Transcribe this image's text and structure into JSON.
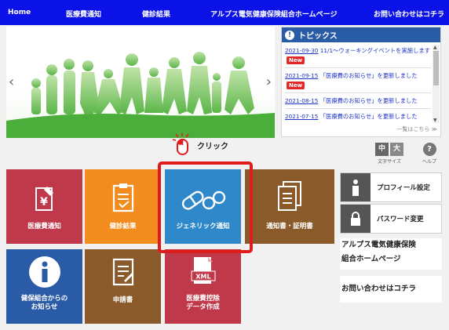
{
  "nav": {
    "items": [
      "Home",
      "医療費通知",
      "健診結果",
      "アルプス電気健康保険組合ホームページ",
      "お問い合わせはコチラ"
    ]
  },
  "hero": {
    "prev_arrow": "‹",
    "next_arrow": "›"
  },
  "topics": {
    "title": "トピックス",
    "icon": "!",
    "items": [
      {
        "date": "2021-09-30",
        "text": "11/1～ウォーキングイベントを実施します！",
        "new": "New"
      },
      {
        "date": "2021-09-15",
        "text": "「医療費のお知らせ」を更新しました",
        "new": "New"
      },
      {
        "date": "2021-08-15",
        "text": "「医療費のお知らせ」を更新しました",
        "new": ""
      },
      {
        "date": "2021-07-15",
        "text": "「医療費のお知らせ」を更新しました",
        "new": ""
      }
    ],
    "more": "一覧はこちら ≫"
  },
  "click_note": "クリック",
  "tools": {
    "font_small": "中",
    "font_large": "大",
    "font_label": "文字サイズ",
    "help_icon": "?",
    "help_label": "ヘルプ"
  },
  "tiles": [
    {
      "label": "医療費通知",
      "color": "#c0394b"
    },
    {
      "label": "健診結果",
      "color": "#f28c1f"
    },
    {
      "label": "ジェネリック通知",
      "color": "#2f88c9"
    },
    {
      "label": "通知書・証明書",
      "color": "#8a5a2b"
    },
    {
      "label": "健保組合からの\nお知らせ",
      "color": "#2a5ba7"
    },
    {
      "label": "申請書",
      "color": "#8a5a2b"
    },
    {
      "label": "医療費控除\nデータ作成",
      "color": "#c0394b",
      "badge": "XML"
    }
  ],
  "side": {
    "profile": "プロフィール設定",
    "password": "パスワード変更",
    "homepage_line1": "アルプス電気健康保険",
    "homepage_line2": "組合ホームページ",
    "contact": "お問い合わせはコチラ"
  },
  "colors": {
    "nav_bg": "#0b12e8",
    "topics_head": "#2a5ba7",
    "highlight": "#e01b1b",
    "new_badge": "#e02828"
  }
}
